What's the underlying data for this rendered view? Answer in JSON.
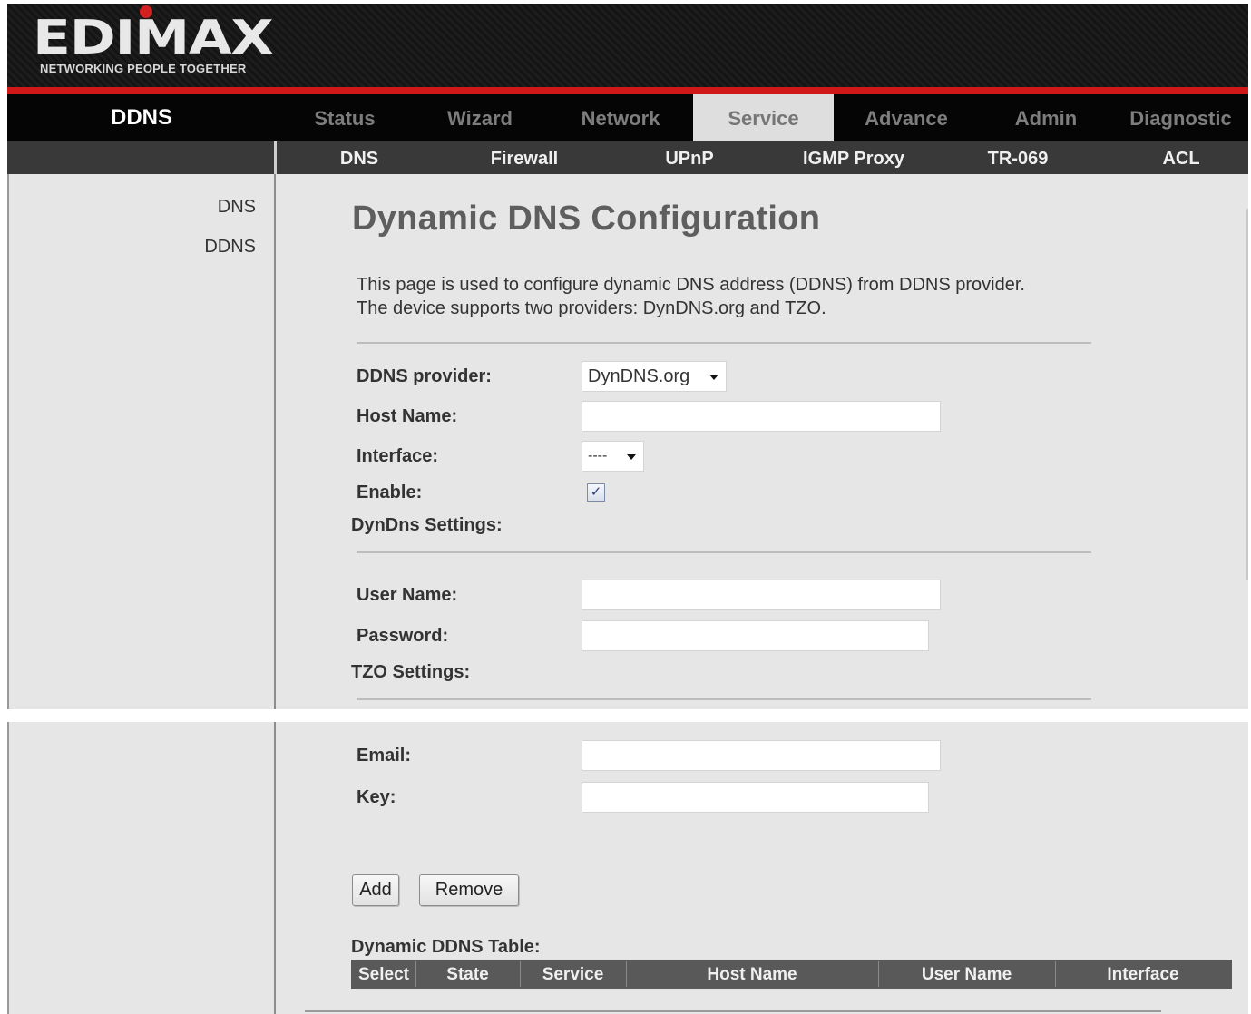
{
  "brand": {
    "logo_text": "EDIMAX",
    "tagline": "NETWORKING PEOPLE TOGETHER",
    "accent_color": "#d01818"
  },
  "section_title": "DDNS",
  "main_nav": {
    "tabs": [
      {
        "label": "Status"
      },
      {
        "label": "Wizard"
      },
      {
        "label": "Network"
      },
      {
        "label": "Service"
      },
      {
        "label": "Advance"
      },
      {
        "label": "Admin"
      },
      {
        "label": "Diagnostic"
      }
    ],
    "active": "Service"
  },
  "sub_nav": {
    "tabs": [
      {
        "label": "DNS"
      },
      {
        "label": "Firewall"
      },
      {
        "label": "UPnP"
      },
      {
        "label": "IGMP Proxy"
      },
      {
        "label": "TR-069"
      },
      {
        "label": "ACL"
      }
    ]
  },
  "sidebar": {
    "items": [
      {
        "label": "DNS"
      },
      {
        "label": "DDNS"
      }
    ]
  },
  "page": {
    "title": "Dynamic DNS Configuration",
    "description_1": "This page is used to configure dynamic DNS address (DDNS) from DDNS provider.",
    "description_2": "The device supports two providers: DynDNS.org and TZO."
  },
  "form": {
    "provider_label": "DDNS provider:",
    "provider_value": "DynDNS.org",
    "host_label": "Host Name:",
    "host_value": "",
    "interface_label": "Interface:",
    "interface_value": "----",
    "enable_label": "Enable:",
    "enable_checked": true,
    "enable_mark": "✓",
    "dyndns_section": "DynDns Settings:",
    "username_label": "User Name:",
    "username_value": "",
    "password_label": "Password:",
    "password_value": "",
    "tzo_section": "TZO Settings:",
    "email_label": "Email:",
    "email_value": "",
    "key_label": "Key:",
    "key_value": "",
    "add_button": "Add",
    "remove_button": "Remove"
  },
  "table": {
    "title": "Dynamic DDNS Table:",
    "columns": [
      "Select",
      "State",
      "Service",
      "Host Name",
      "User Name",
      "Interface"
    ],
    "rows": []
  }
}
